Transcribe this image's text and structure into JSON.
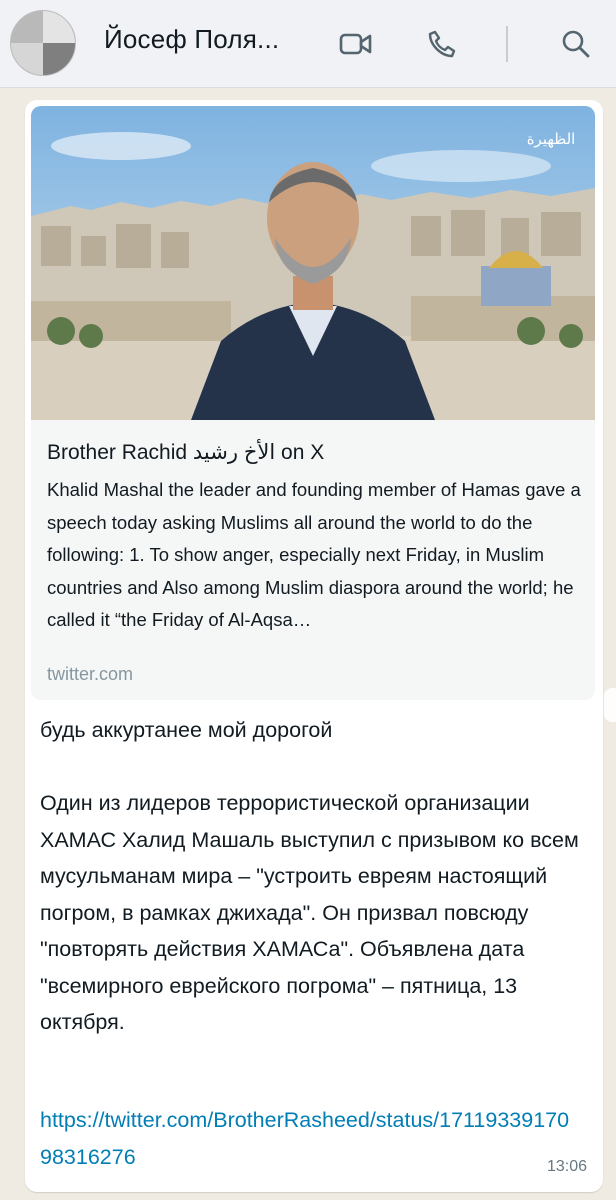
{
  "header": {
    "contact_name": "Йосеф Поля...",
    "icons": [
      "video-call-icon",
      "phone-call-icon",
      "search-icon"
    ]
  },
  "message": {
    "link_preview": {
      "title": "Brother Rachid الأخ رشيد on X",
      "description": "Khalid Mashal the leader and founding member of Hamas gave a speech today asking Muslims all around the world to do the following: 1. To show anger, especially next Friday, in Muslim countries and Also among Muslim diaspora around the world; he called it “the Friday of Al-Aqsa…",
      "domain": "twitter.com",
      "watermark": "الظهيرة"
    },
    "text": "будь аккуртанее мой дорогой\n\nОдин из лидеров террористической организации ХАМАС Халид Машаль выступил с призывом ко всем мусульманам мира – \"устроить евреям настоящий погром, в рамках джихада\". Он призвал повсюду \"повторять действия ХАМАСа\". Объявлена дата \"всемирного еврейского погрома\" – пятница, 13 октября.",
    "link": "https://twitter.com/BrotherRasheed/status/1711933917098316276",
    "time": "13:06"
  },
  "colors": {
    "header_bg": "#f0f2f5",
    "chat_bg": "#efeae2",
    "bubble_bg": "#ffffff",
    "link": "#027eb5",
    "muted": "#8696a0"
  }
}
